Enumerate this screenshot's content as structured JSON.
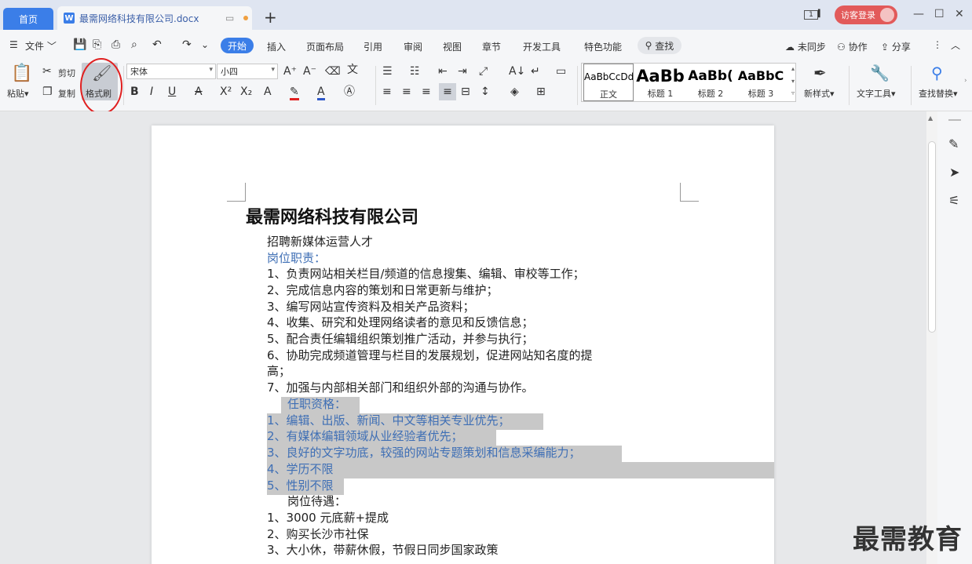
{
  "tabs": {
    "home_label": "首页",
    "doc_title": "最需网络科技有限公司.docx"
  },
  "header_right": {
    "page_indicator": "1",
    "login_label": "访客登录"
  },
  "menu": {
    "file_label": "文件",
    "items": [
      "开始",
      "插入",
      "页面布局",
      "引用",
      "审阅",
      "视图",
      "章节",
      "开发工具",
      "特色功能"
    ],
    "search_label": "查找",
    "sync_label": "未同步",
    "collab_label": "协作",
    "share_label": "分享"
  },
  "ribbon": {
    "paste_label": "粘贴",
    "cut_label": "剪切",
    "copy_label": "复制",
    "format_painter_label": "格式刷",
    "font_name": "宋体",
    "font_size": "小四",
    "styles": [
      {
        "preview": "AaBbCcDd",
        "name": "正文"
      },
      {
        "preview": "AaBb",
        "name": "标题 1"
      },
      {
        "preview": "AaBb(",
        "name": "标题 2"
      },
      {
        "preview": "AaBbC",
        "name": "标题 3"
      }
    ],
    "new_style_label": "新样式",
    "text_tools_label": "文字工具",
    "find_replace_label": "查找替换"
  },
  "document": {
    "heading": "最需网络科技有限公司",
    "lines": [
      {
        "text": "招聘新媒体运营人才"
      },
      {
        "text": "岗位职责："
      },
      {
        "text": "1、负责网站相关栏目/频道的信息搜集、编辑、审校等工作；"
      },
      {
        "text": "2、完成信息内容的策划和日常更新与维护；"
      },
      {
        "text": "3、编写网站宣传资料及相关产品资料；"
      },
      {
        "text": "4、收集、研究和处理网络读者的意见和反馈信息；"
      },
      {
        "text": "5、配合责任编辑组织策划推广活动，并参与执行；"
      },
      {
        "text": "6、协助完成频道管理与栏目的发展规划，促进网站知名度的提"
      },
      {
        "text": "高；"
      },
      {
        "text": "7、加强与内部相关部门和组织外部的沟通与协作。"
      },
      {
        "text": "任职资格："
      },
      {
        "text": "1、编辑、出版、新闻、中文等相关专业优先；"
      },
      {
        "text": "2、有媒体编辑领域从业经验者优先；"
      },
      {
        "text": "3、良好的文字功底，较强的网站专题策划和信息采编能力；"
      },
      {
        "text": "4、学历不限"
      },
      {
        "text": "5、性别不限"
      },
      {
        "text": "岗位待遇："
      },
      {
        "text": "1、3000 元底薪+提成"
      },
      {
        "text": "2、购买长沙市社保"
      },
      {
        "text": "3、大小休，带薪休假，节假日同步国家政策"
      }
    ]
  },
  "watermark": "最需教育"
}
